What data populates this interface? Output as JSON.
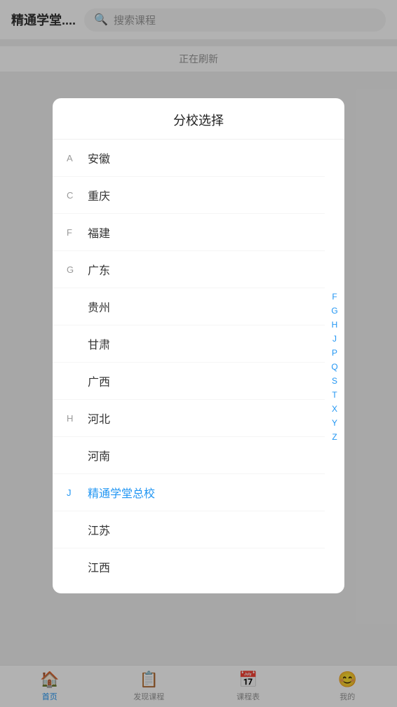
{
  "header": {
    "title": "精通学堂....",
    "search_placeholder": "搜索课程"
  },
  "background": {
    "refresh_text": "正在刷新"
  },
  "modal": {
    "title": "分校选择",
    "items": [
      {
        "section": "A",
        "name": "安徽",
        "active": false
      },
      {
        "section": "C",
        "name": "重庆",
        "active": false
      },
      {
        "section": "F",
        "name": "福建",
        "active": false
      },
      {
        "section": "G",
        "name": "广东",
        "active": false
      },
      {
        "section": "",
        "name": "贵州",
        "active": false
      },
      {
        "section": "",
        "name": "甘肃",
        "active": false
      },
      {
        "section": "",
        "name": "广西",
        "active": false
      },
      {
        "section": "H",
        "name": "河北",
        "active": false
      },
      {
        "section": "",
        "name": "河南",
        "active": false
      },
      {
        "section": "J",
        "name": "精通学堂总校",
        "active": true
      },
      {
        "section": "",
        "name": "江苏",
        "active": false
      },
      {
        "section": "",
        "name": "江西",
        "active": false
      }
    ],
    "alpha_index": [
      "F",
      "G",
      "H",
      "J",
      "P",
      "Q",
      "S",
      "T",
      "X",
      "Y",
      "Z"
    ]
  },
  "bottom_nav": {
    "items": [
      {
        "label": "首页",
        "icon": "🏠",
        "active": true
      },
      {
        "label": "发现课程",
        "icon": "📋",
        "active": false
      },
      {
        "label": "课程表",
        "icon": "📅",
        "active": false
      },
      {
        "label": "我的",
        "icon": "😊",
        "active": false
      }
    ]
  }
}
